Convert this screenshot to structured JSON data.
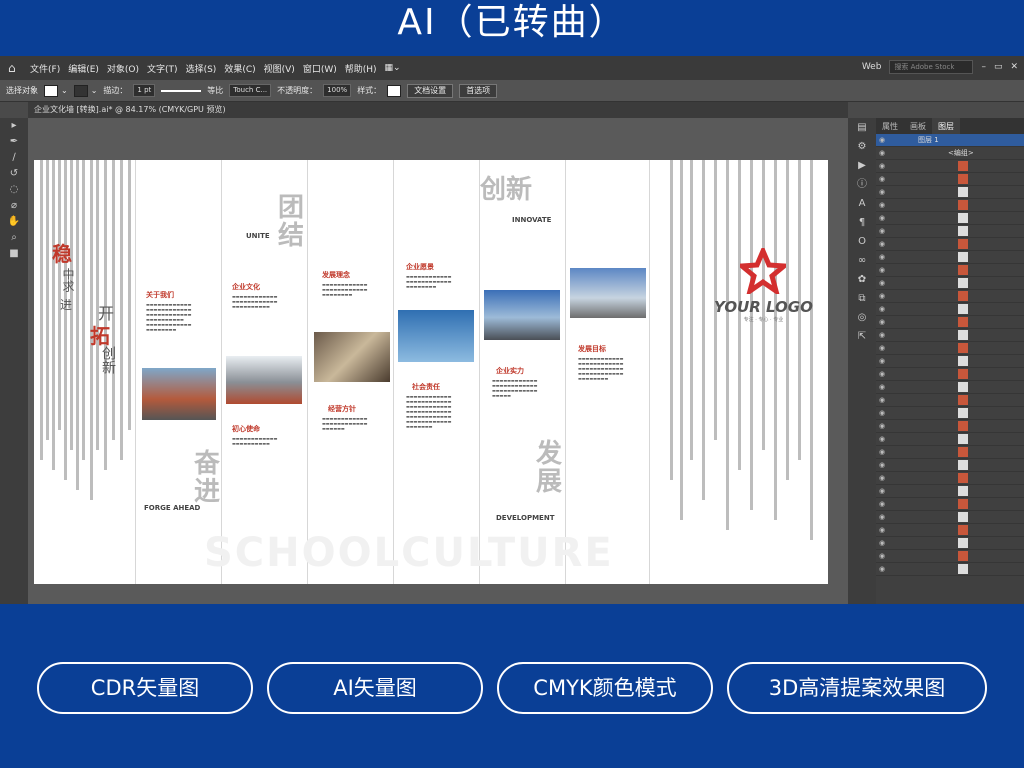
{
  "banner": {
    "title": "AI（已转曲）"
  },
  "menubar": {
    "items": [
      "文件(F)",
      "编辑(E)",
      "对象(O)",
      "文字(T)",
      "选择(S)",
      "效果(C)",
      "视图(V)",
      "窗口(W)",
      "帮助(H)"
    ],
    "workspace": "Web",
    "search_placeholder": "搜索 Adobe Stock"
  },
  "control": {
    "select_label": "选择对象",
    "stroke_label": "描边：",
    "stroke_value": "1 pt",
    "stroke_style": "等比",
    "brush": "Touch C...",
    "opacity_label": "不透明度：",
    "opacity_value": "100%",
    "style_label": "样式：",
    "doc_setup": "文档设置",
    "prefs": "首选项"
  },
  "tab": {
    "title": "企业文化墙 [转换].ai* @ 84.17% (CMYK/GPU 预览)"
  },
  "artboard": {
    "left_slogan": {
      "a": "稳",
      "b": "中求",
      "c": "进",
      "d": "开",
      "e": "拓",
      "f": "创新"
    },
    "sections": {
      "about": "关于我们",
      "culture": "企业文化",
      "concept": "发展理念",
      "vision": "企业愿景",
      "mission": "初心使命",
      "policy": "经营方针",
      "social": "社会责任",
      "strength": "企业实力",
      "goal": "发展目标"
    },
    "big_chars": {
      "unite": "团结",
      "innovate": "创新",
      "forge": "奋进",
      "develop": "发展"
    },
    "english": {
      "unite": "UNITE",
      "innovate": "INNOVATE",
      "forge": "FORGE AHEAD",
      "develop": "DEVELOPMENT"
    },
    "logo_text": "YOUR LOGO",
    "logo_sub": "专注 · 专心 · 专业",
    "school": "SCHOOLCULTURE"
  },
  "layers": {
    "tabs": [
      "属性",
      "画板",
      "图层"
    ],
    "layer1": "图层 1",
    "group": "<编组>"
  },
  "badges": [
    "CDR矢量图",
    "AI矢量图",
    "CMYK颜色模式",
    "3D高清提案效果图"
  ],
  "colors": {
    "brand_blue": "#0a3f96",
    "accent_red": "#c0392b",
    "logo_red": "#d32f2f"
  }
}
